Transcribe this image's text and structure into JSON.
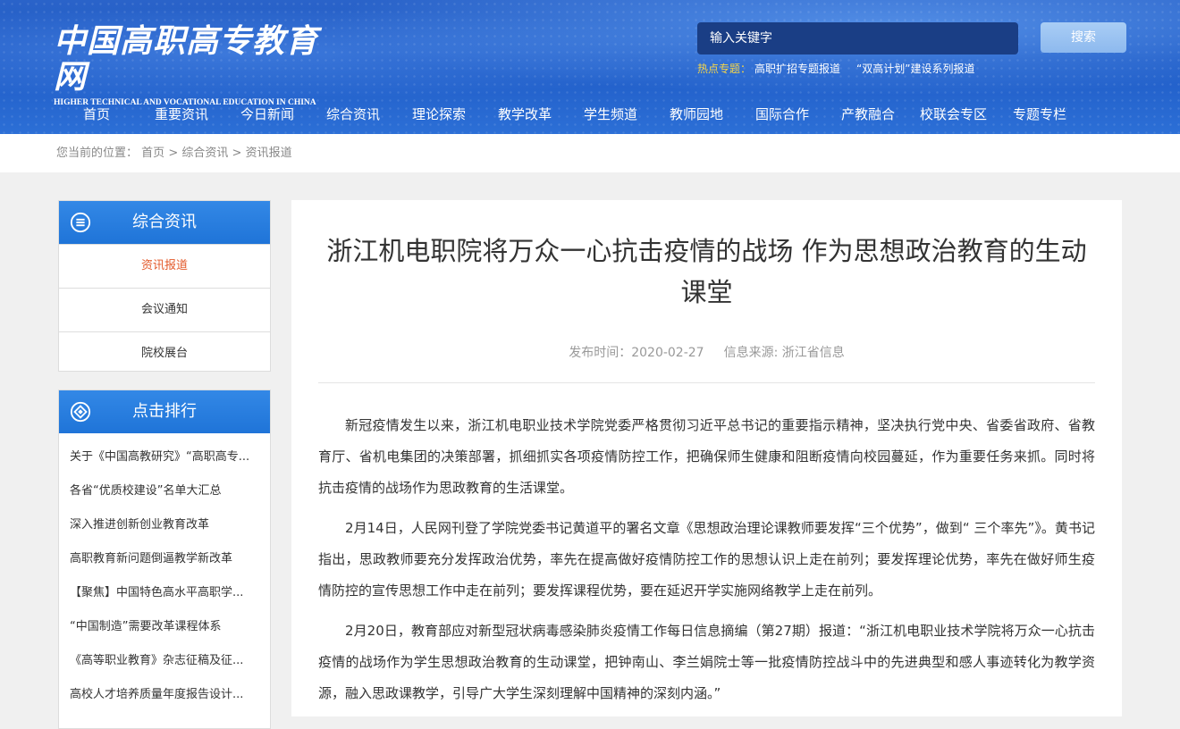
{
  "header": {
    "logo_cn": "中国高职高专教育网",
    "logo_en": "HIGHER TECHNICAL AND VOCATIONAL EDUCATION IN CHINA",
    "search_placeholder": "输入关键字",
    "search_button": "搜索",
    "hot_label": "热点专题：",
    "hot_links": [
      "高职扩招专题报道",
      "“双高计划”建设系列报道"
    ]
  },
  "nav": {
    "items": [
      "首页",
      "重要资讯",
      "今日新闻",
      "综合资讯",
      "理论探索",
      "教学改革",
      "学生频道",
      "教师园地",
      "国际合作",
      "产教融合",
      "校联会专区",
      "专题专栏"
    ]
  },
  "breadcrumb": {
    "prefix": "您当前的位置：",
    "items": [
      "首页",
      "综合资讯",
      "资讯报道"
    ],
    "separator": ">"
  },
  "sidebar": {
    "section1": {
      "title": "综合资讯",
      "items": [
        "资讯报道",
        "会议通知",
        "院校展台"
      ]
    },
    "section2": {
      "title": "点击排行",
      "items": [
        "关于《中国高教研究》“高职高专...",
        "各省“优质校建设”名单大汇总",
        "深入推进创新创业教育改革",
        "高职教育新问题倒逼教学新改革",
        "【聚焦】中国特色高水平高职学...",
        "“中国制造”需要改革课程体系",
        "《高等职业教育》杂志征稿及征...",
        "高校人才培养质量年度报告设计..."
      ]
    }
  },
  "article": {
    "title": "浙江机电职院将万众一心抗击疫情的战场 作为思想政治教育的生动课堂",
    "publish_time": "发布时间：2020-02-27",
    "source": "信息来源: 浙江省信息",
    "paragraphs": [
      "新冠疫情发生以来，浙江机电职业技术学院党委严格贯彻习近平总书记的重要指示精神，坚决执行党中央、省委省政府、省教育厅、省机电集团的决策部署，抓细抓实各项疫情防控工作，把确保师生健康和阻断疫情向校园蔓延，作为重要任务来抓。同时将抗击疫情的战场作为思政教育的生活课堂。",
      "2月14日，人民网刊登了学院党委书记黄道平的署名文章《思想政治理论课教师要发挥“三个优势”，做到“ 三个率先”》。黄书记指出，思政教师要充分发挥政治优势，率先在提高做好疫情防控工作的思想认识上走在前列；要发挥理论优势，率先在做好师生疫情防控的宣传思想工作中走在前列；要发挥课程优势，要在延迟开学实施网络教学上走在前列。",
      "2月20日，教育部应对新型冠状病毒感染肺炎疫情工作每日信息摘编（第27期）报道：“浙江机电职业技术学院将万众一心抗击疫情的战场作为学生思想政治教育的生动课堂，把钟南山、李兰娟院士等一批疫情防控战斗中的先进典型和感人事迹转化为教学资源，融入思政课教学，引导广大学生深刻理解中国精神的深刻内涵。”"
    ]
  },
  "colors": {
    "header_blue": "#1f5bc6",
    "active_link": "#e35a2b",
    "hot_label": "#f5d54a",
    "sidebar_head": "#1f74d8"
  }
}
